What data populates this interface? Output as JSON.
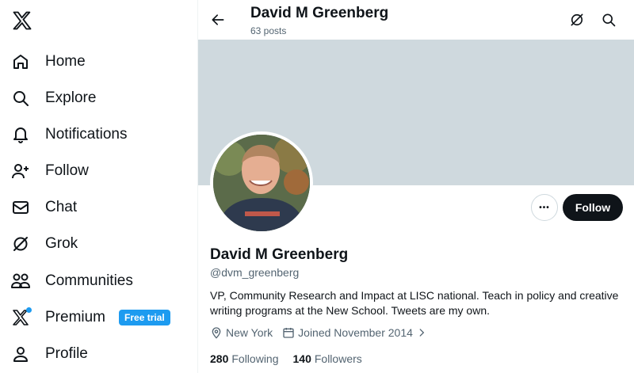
{
  "sidebar": {
    "logo": "x-logo-icon",
    "items": [
      {
        "label": "Home",
        "icon": "home-icon"
      },
      {
        "label": "Explore",
        "icon": "search-icon"
      },
      {
        "label": "Notifications",
        "icon": "bell-icon"
      },
      {
        "label": "Follow",
        "icon": "person-plus-icon"
      },
      {
        "label": "Chat",
        "icon": "mail-icon"
      },
      {
        "label": "Grok",
        "icon": "grok-icon"
      },
      {
        "label": "Communities",
        "icon": "people-icon"
      },
      {
        "label": "Premium",
        "icon": "x-logo-icon",
        "badge": "Free trial"
      },
      {
        "label": "Profile",
        "icon": "person-icon"
      }
    ]
  },
  "header": {
    "title": "David M Greenberg",
    "subtitle": "63 posts"
  },
  "profile": {
    "name": "David M Greenberg",
    "handle": "@dvm_greenberg",
    "bio": "VP, Community Research and Impact at LISC national. Teach in policy and creative writing programs at the New School. Tweets are my own.",
    "location": "New York",
    "joined": "Joined November 2014",
    "following_count": "280",
    "following_label": "Following",
    "followers_count": "140",
    "followers_label": "Followers",
    "follow_button": "Follow",
    "more_label": "•••"
  },
  "colors": {
    "accent": "#1d9bf0",
    "banner": "#cfd9de",
    "text": "#0f1419",
    "muted": "#536471"
  }
}
